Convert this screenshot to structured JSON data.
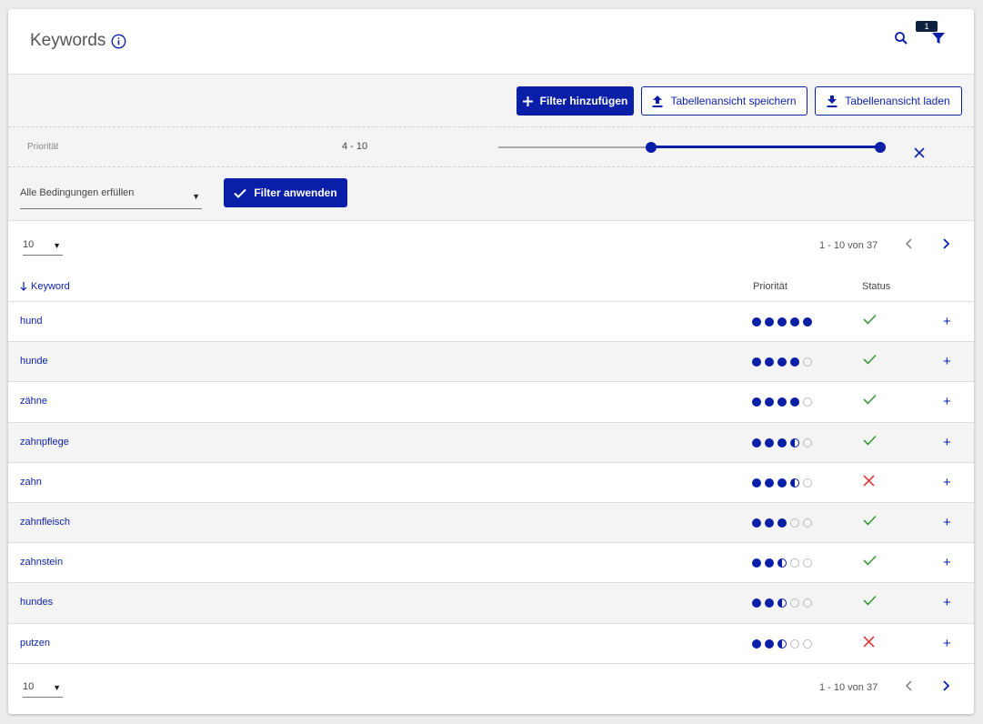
{
  "header": {
    "title": "Keywords",
    "filter_badge": "1"
  },
  "toolbar": {
    "add_filter": "Filter hinzufügen",
    "save_view": "Tabellenansicht speichern",
    "load_view": "Tabellenansicht laden"
  },
  "filter": {
    "label": "Priorität",
    "range": "4 - 10",
    "slider_min": 4,
    "slider_max": 10,
    "slider_scale": [
      0,
      10
    ],
    "condition": "Alle Bedingungen erfüllen",
    "apply": "Filter anwenden"
  },
  "pager": {
    "page_size": "10",
    "range_text": "1 - 10 von 37"
  },
  "table": {
    "columns": {
      "keyword": "Keyword",
      "priority": "Priorität",
      "status": "Status"
    },
    "rows": [
      {
        "keyword": "hund",
        "priority": [
          "full",
          "full",
          "full",
          "full",
          "full"
        ],
        "status": "ok"
      },
      {
        "keyword": "hunde",
        "priority": [
          "full",
          "full",
          "full",
          "full",
          "empty"
        ],
        "status": "ok"
      },
      {
        "keyword": "zähne",
        "priority": [
          "full",
          "full",
          "full",
          "full",
          "empty"
        ],
        "status": "ok"
      },
      {
        "keyword": "zahnpflege",
        "priority": [
          "full",
          "full",
          "full",
          "half",
          "empty"
        ],
        "status": "ok"
      },
      {
        "keyword": "zahn",
        "priority": [
          "full",
          "full",
          "full",
          "half",
          "empty"
        ],
        "status": "error"
      },
      {
        "keyword": "zahnfleisch",
        "priority": [
          "full",
          "full",
          "full",
          "empty",
          "empty"
        ],
        "status": "ok"
      },
      {
        "keyword": "zahnstein",
        "priority": [
          "full",
          "full",
          "half",
          "empty",
          "empty"
        ],
        "status": "ok"
      },
      {
        "keyword": "hundes",
        "priority": [
          "full",
          "full",
          "half",
          "empty",
          "empty"
        ],
        "status": "ok"
      },
      {
        "keyword": "putzen",
        "priority": [
          "full",
          "full",
          "half",
          "empty",
          "empty"
        ],
        "status": "error"
      }
    ]
  },
  "colors": {
    "accent": "#0a1fa8",
    "ok": "#3c9a3c",
    "error": "#e03c3c"
  }
}
